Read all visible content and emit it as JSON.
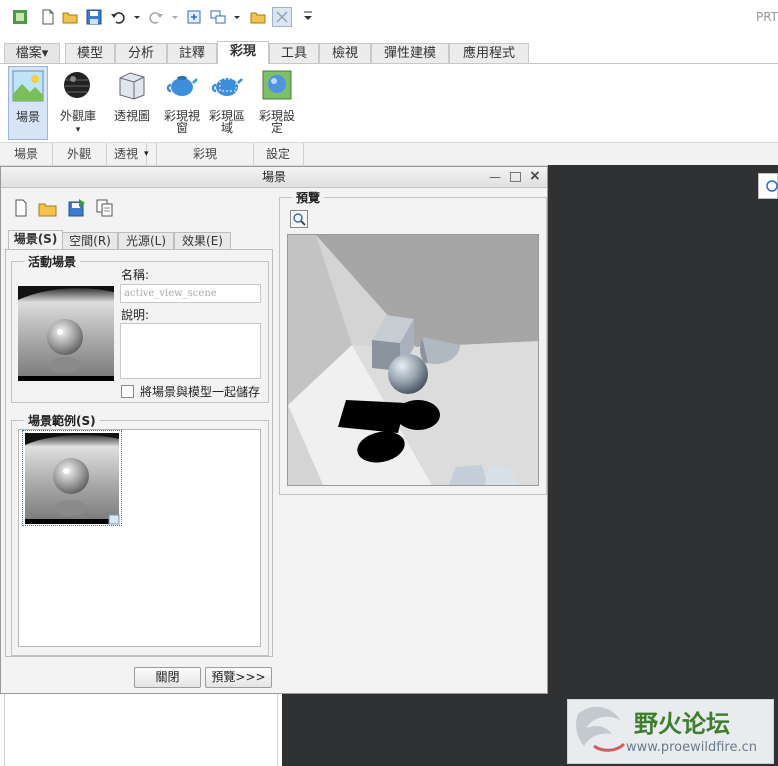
{
  "app": {
    "title": "PRT"
  },
  "ribbon_tabs": [
    {
      "label": "檔案▾"
    },
    {
      "label": "模型"
    },
    {
      "label": "分析"
    },
    {
      "label": "註釋"
    },
    {
      "label": "彩現"
    },
    {
      "label": "工具"
    },
    {
      "label": "檢視"
    },
    {
      "label": "彈性建模"
    },
    {
      "label": "應用程式"
    }
  ],
  "ribbon": {
    "scene": "場景",
    "appearance_gallery": "外觀庫",
    "perspective": "透視圖",
    "render_window_1": "彩現視",
    "render_window_2": "窗",
    "render_region_1": "彩現區",
    "render_region_2": "域",
    "render_settings_1": "彩現設",
    "render_settings_2": "定",
    "groups": [
      "場景",
      "外觀",
      "透視",
      "彩現",
      "設定"
    ]
  },
  "dialog": {
    "title": "場景",
    "tabs": [
      "場景(S)",
      "空間(R)",
      "光源(L)",
      "效果(E)"
    ],
    "active_scene_legend": "活動場景",
    "name_label": "名稱:",
    "name_value": "active_view_scene",
    "description_label": "說明:",
    "save_with_model": "將場景與模型一起儲存",
    "scene_examples_legend": "場景範例(S)",
    "preview_legend": "預覽",
    "close_button": "關閉",
    "preview_button": "預覽>>>"
  },
  "watermark": {
    "title": "野火论坛",
    "url": "www.proewildfire.cn"
  },
  "colors": {
    "accent": "#2b6cc4",
    "graphics_bg": "#2f3133",
    "dialog_bg": "#f3f3f3"
  }
}
